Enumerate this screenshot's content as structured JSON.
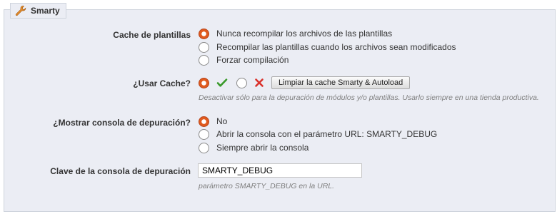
{
  "section": {
    "title": "Smarty",
    "icon": "wrench-icon"
  },
  "cache_templates": {
    "label": "Cache de plantillas",
    "options": [
      {
        "label": "Nunca recompilar los archivos de las plantillas",
        "checked": true
      },
      {
        "label": "Recompilar las plantillas cuando los archivos sean modificados",
        "checked": false
      },
      {
        "label": "Forzar compilación",
        "checked": false
      }
    ]
  },
  "use_cache": {
    "label": "¿Usar Cache?",
    "yes_icon": "check-icon",
    "no_icon": "cross-icon",
    "selected": "yes",
    "clear_button": "Limpiar la cache Smarty & Autoload",
    "hint": "Desactivar sólo para la depuración de módulos y/o plantillas. Usarlo siempre en una tienda productiva."
  },
  "debug_console": {
    "label": "¿Mostrar consola de depuración?",
    "options": [
      {
        "label": "No",
        "checked": true
      },
      {
        "label": "Abrir la consola con el parámetro URL: SMARTY_DEBUG",
        "checked": false
      },
      {
        "label": "Siempre abrir la consola",
        "checked": false
      }
    ]
  },
  "debug_key": {
    "label": "Clave de la consola de depuración",
    "value": "SMARTY_DEBUG",
    "hint": "parámetro SMARTY_DEBUG en la URL."
  },
  "colors": {
    "radio_checked": "#e05a1e",
    "check_green": "#3a9a2b",
    "cross_red": "#d9302a",
    "panel_bg": "#ebedf4"
  }
}
